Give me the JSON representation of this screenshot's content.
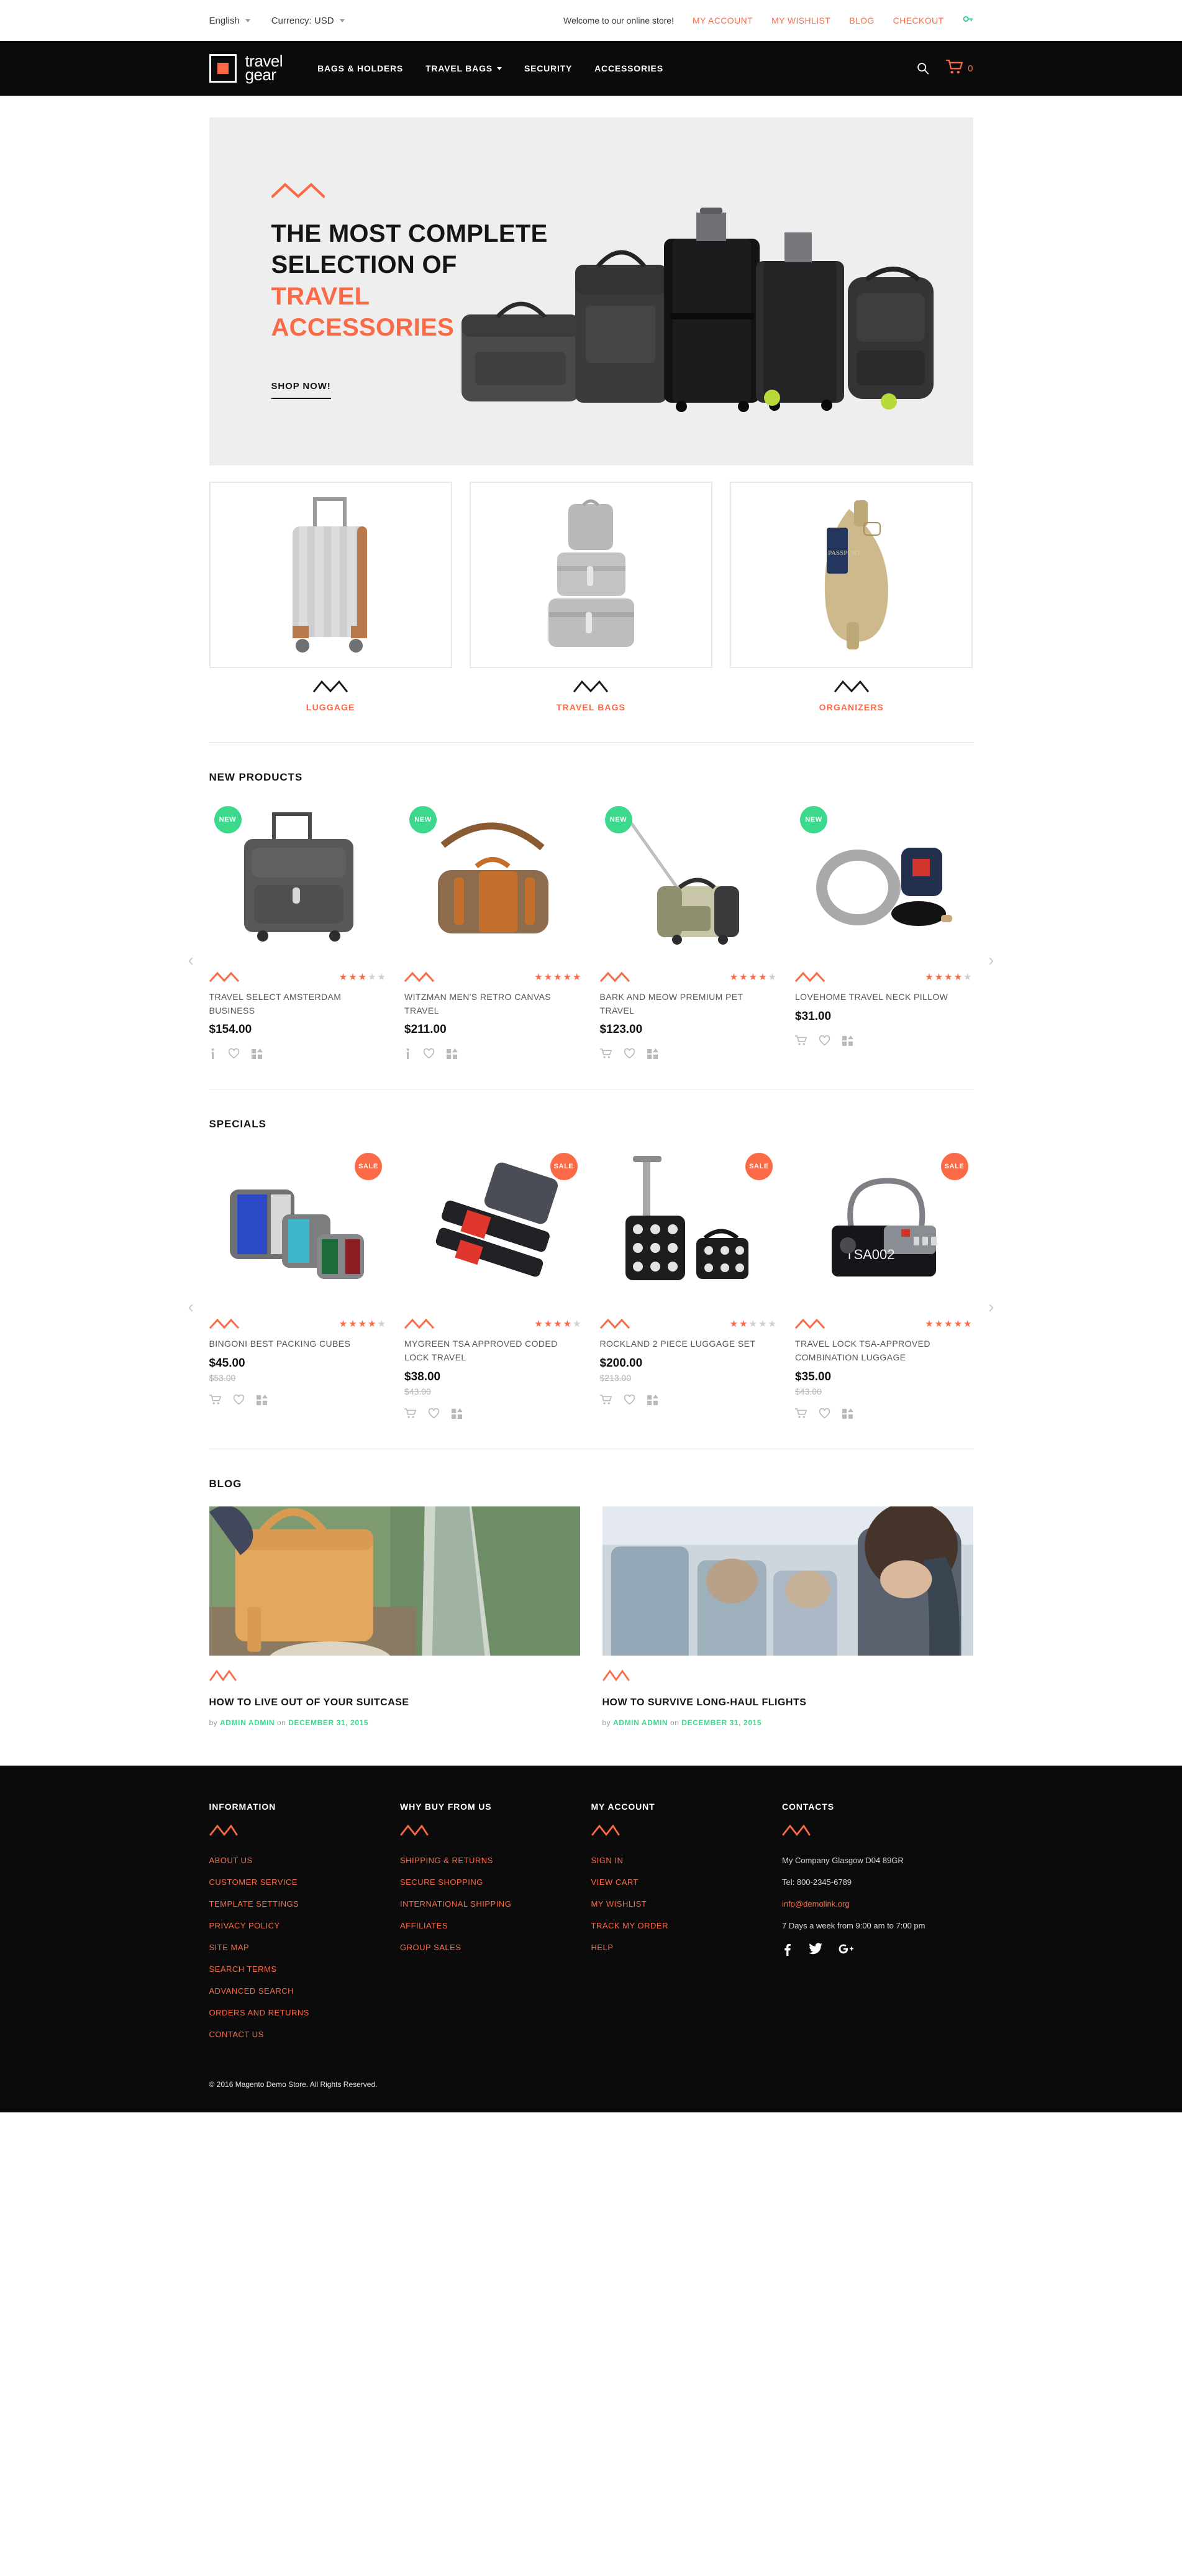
{
  "topbar": {
    "language": "English",
    "currency": "Currency: USD",
    "welcome": "Welcome to our online store!",
    "links": [
      "MY ACCOUNT",
      "MY WISHLIST",
      "BLOG",
      "CHECKOUT"
    ],
    "key_icon": "key-icon"
  },
  "header": {
    "logo_line1": "travel",
    "logo_line2": "gear",
    "nav": [
      {
        "label": "BAGS & HOLDERS",
        "has_caret": false
      },
      {
        "label": "TRAVEL BAGS",
        "has_caret": true
      },
      {
        "label": "SECURITY",
        "has_caret": false
      },
      {
        "label": "ACCESSORIES",
        "has_caret": false
      }
    ],
    "cart_count": "0"
  },
  "hero": {
    "line1": "THE MOST COMPLETE",
    "line2": "SELECTION OF",
    "line3": "TRAVEL",
    "line4": "ACCESSORIES",
    "cta": "SHOP NOW!"
  },
  "categories": [
    {
      "label": "LUGGAGE"
    },
    {
      "label": "TRAVEL BAGS"
    },
    {
      "label": "ORGANIZERS"
    }
  ],
  "new_products": {
    "title": "NEW PRODUCTS",
    "items": [
      {
        "badge": "NEW",
        "badge_type": "new",
        "name": "TRAVEL SELECT AMSTERDAM BUSINESS",
        "price": "$154.00",
        "old_price": "",
        "rating": 3,
        "actions": [
          "info-icon",
          "wishlist-heart-icon",
          "compare-icon"
        ]
      },
      {
        "badge": "NEW",
        "badge_type": "new",
        "name": "WITZMAN MEN'S RETRO CANVAS TRAVEL",
        "price": "$211.00",
        "old_price": "",
        "rating": 5,
        "actions": [
          "info-icon",
          "wishlist-heart-icon",
          "compare-icon"
        ]
      },
      {
        "badge": "NEW",
        "badge_type": "new",
        "name": "BARK AND MEOW PREMIUM PET TRAVEL",
        "price": "$123.00",
        "old_price": "",
        "rating": 4,
        "actions": [
          "add-to-cart-icon",
          "wishlist-heart-icon",
          "compare-icon"
        ]
      },
      {
        "badge": "NEW",
        "badge_type": "new",
        "name": "LOVEHOME TRAVEL NECK PILLOW",
        "price": "$31.00",
        "old_price": "",
        "rating": 4,
        "actions": [
          "add-to-cart-icon",
          "wishlist-heart-icon",
          "compare-icon"
        ]
      }
    ]
  },
  "specials": {
    "title": "SPECIALS",
    "items": [
      {
        "badge": "SALE",
        "badge_type": "sale",
        "name": "BINGONI BEST PACKING CUBES",
        "price": "$45.00",
        "old_price": "$53.00",
        "rating": 4,
        "actions": [
          "add-to-cart-icon",
          "wishlist-heart-icon",
          "compare-icon"
        ]
      },
      {
        "badge": "SALE",
        "badge_type": "sale",
        "name": "MYGREEN TSA APPROVED CODED LOCK TRAVEL",
        "price": "$38.00",
        "old_price": "$43.00",
        "rating": 4,
        "actions": [
          "add-to-cart-icon",
          "wishlist-heart-icon",
          "compare-icon"
        ]
      },
      {
        "badge": "SALE",
        "badge_type": "sale",
        "name": "ROCKLAND 2 PIECE LUGGAGE SET",
        "price": "$200.00",
        "old_price": "$213.00",
        "rating": 2,
        "actions": [
          "add-to-cart-icon",
          "wishlist-heart-icon",
          "compare-icon"
        ]
      },
      {
        "badge": "SALE",
        "badge_type": "sale",
        "name": "TRAVEL LOCK TSA-APPROVED COMBINATION LUGGAGE",
        "price": "$35.00",
        "old_price": "$43.00",
        "rating": 5,
        "actions": [
          "add-to-cart-icon",
          "wishlist-heart-icon",
          "compare-icon"
        ]
      }
    ]
  },
  "blog": {
    "title": "BLOG",
    "posts": [
      {
        "title": "HOW TO LIVE OUT OF YOUR SUITCASE",
        "by_label": "by",
        "author": "ADMIN ADMIN",
        "on_label": "on",
        "date": "DECEMBER 31, 2015"
      },
      {
        "title": "HOW TO SURVIVE LONG-HAUL FLIGHTS",
        "by_label": "by",
        "author": "ADMIN ADMIN",
        "on_label": "on",
        "date": "DECEMBER 31, 2015"
      }
    ]
  },
  "footer": {
    "columns": [
      {
        "title": "INFORMATION",
        "links": [
          "ABOUT US",
          "CUSTOMER SERVICE",
          "TEMPLATE SETTINGS",
          "PRIVACY POLICY",
          "SITE MAP",
          "SEARCH TERMS",
          "ADVANCED SEARCH",
          "ORDERS AND RETURNS",
          "CONTACT US"
        ]
      },
      {
        "title": "WHY BUY FROM US",
        "links": [
          "SHIPPING & RETURNS",
          "SECURE SHOPPING",
          "INTERNATIONAL SHIPPING",
          "AFFILIATES",
          "GROUP SALES"
        ]
      },
      {
        "title": "MY ACCOUNT",
        "links": [
          "SIGN IN",
          "VIEW CART",
          "MY WISHLIST",
          "TRACK MY ORDER",
          "HELP"
        ]
      }
    ],
    "contacts": {
      "title": "CONTACTS",
      "address": "My Company Glasgow D04 89GR",
      "tel": "Tel: 800-2345-6789",
      "email": "info@demolink.org",
      "hours": "7 Days a week from 9:00 am to 7:00 pm",
      "socials": [
        "facebook-icon",
        "twitter-icon",
        "google-plus-icon"
      ]
    },
    "copyright": "© 2016 Magento Demo Store. All Rights Reserved."
  },
  "colors": {
    "accent": "#FB6A46",
    "new_badge": "#3CD98C",
    "dark": "#0B0B0B",
    "hero_bg": "#EEEEEE"
  }
}
